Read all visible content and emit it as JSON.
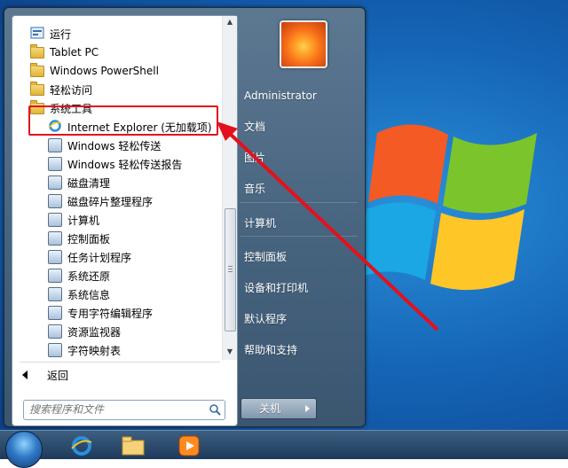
{
  "start_menu": {
    "programs": [
      {
        "label": "运行",
        "icon": "run-icon",
        "level": 1
      },
      {
        "label": "Tablet PC",
        "icon": "folder-icon",
        "level": 1
      },
      {
        "label": "Windows PowerShell",
        "icon": "folder-icon",
        "level": 1
      },
      {
        "label": "轻松访问",
        "icon": "folder-icon",
        "level": 1
      },
      {
        "label": "系统工具",
        "icon": "folder-icon",
        "level": 1
      },
      {
        "label": "Internet Explorer (无加载项)",
        "icon": "ie-icon",
        "level": 2
      },
      {
        "label": "Windows 轻松传送",
        "icon": "transfer-icon",
        "level": 2
      },
      {
        "label": "Windows 轻松传送报告",
        "icon": "transfer-report-icon",
        "level": 2
      },
      {
        "label": "磁盘清理",
        "icon": "disk-cleanup-icon",
        "level": 2
      },
      {
        "label": "磁盘碎片整理程序",
        "icon": "defrag-icon",
        "level": 2
      },
      {
        "label": "计算机",
        "icon": "computer-icon",
        "level": 2
      },
      {
        "label": "控制面板",
        "icon": "control-panel-icon",
        "level": 2
      },
      {
        "label": "任务计划程序",
        "icon": "task-scheduler-icon",
        "level": 2
      },
      {
        "label": "系统还原",
        "icon": "system-restore-icon",
        "level": 2
      },
      {
        "label": "系统信息",
        "icon": "system-info-icon",
        "level": 2
      },
      {
        "label": "专用字符编辑程序",
        "icon": "char-editor-icon",
        "level": 2
      },
      {
        "label": "资源监视器",
        "icon": "resource-monitor-icon",
        "level": 2
      },
      {
        "label": "字符映射表",
        "icon": "char-map-icon",
        "level": 2
      }
    ],
    "back_label": "返回",
    "search_placeholder": "搜索程序和文件",
    "right_items": [
      "Administrator",
      "文档",
      "图片",
      "音乐",
      "计算机",
      "控制面板",
      "设备和打印机",
      "默认程序",
      "帮助和支持"
    ],
    "shutdown_label": "关机"
  },
  "colors": {
    "highlight": "#e3111c",
    "menu_frame": "#4f6b86"
  }
}
